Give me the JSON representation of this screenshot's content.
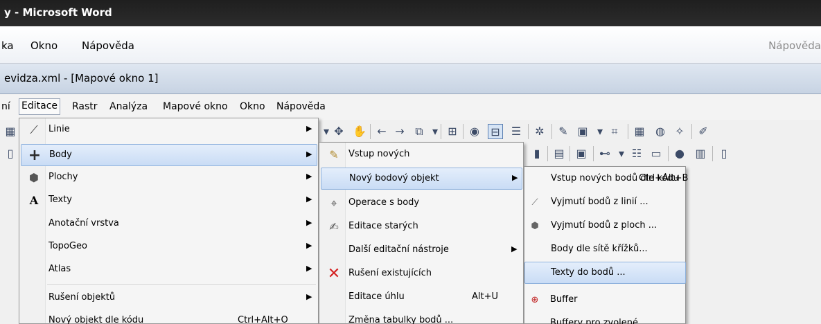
{
  "word": {
    "title": "y - Microsoft Word",
    "menu": [
      "ka",
      "Okno",
      "Nápověda"
    ],
    "help_box": "Nápověda"
  },
  "app": {
    "title": "evidza.xml - [Mapové okno 1]",
    "menu": [
      "ní",
      "Editace",
      "Rastr",
      "Analýza",
      "Mapové okno",
      "Okno",
      "Nápověda"
    ]
  },
  "menus": {
    "editace": [
      {
        "label": "Linie",
        "icon": "line-icon"
      },
      {
        "label": "Body",
        "icon": "plus-icon"
      },
      {
        "label": "Plochy",
        "icon": "polygon-icon"
      },
      {
        "label": "Texty",
        "icon": "text-icon"
      },
      {
        "label": "Anotační vrstva"
      },
      {
        "label": "TopoGeo"
      },
      {
        "label": "Atlas"
      },
      {
        "label": "Rušení objektů"
      },
      {
        "label": "Nový objekt dle kódu",
        "shortcut": "Ctrl+Alt+O"
      }
    ],
    "body": [
      {
        "label": "Vstup nových"
      },
      {
        "label": "Nový bodový objekt"
      },
      {
        "label": "Operace s body"
      },
      {
        "label": "Editace starých"
      },
      {
        "label": "Další editační nástroje"
      },
      {
        "label": "Rušení existujících"
      },
      {
        "label": "Editace úhlu",
        "shortcut": "Alt+U"
      },
      {
        "label": "Změna tabulky bodů ..."
      }
    ],
    "novy_bodovy": [
      {
        "label": "Vstup nových bodů dle kódu",
        "shortcut": "Ctrl+Alt+B"
      },
      {
        "label": "Vyjmutí bodů z linií ..."
      },
      {
        "label": "Vyjmutí bodů z ploch ..."
      },
      {
        "label": "Body dle sítě křížků..."
      },
      {
        "label": "Texty do bodů ..."
      },
      {
        "label": "Buffer"
      },
      {
        "label": "Buffery pro zvolené"
      }
    ]
  },
  "colors": {
    "highlight_bg": "#c9dcf5",
    "highlight_border": "#8fb2dd",
    "word_title_bg": "#1f1f1f"
  }
}
